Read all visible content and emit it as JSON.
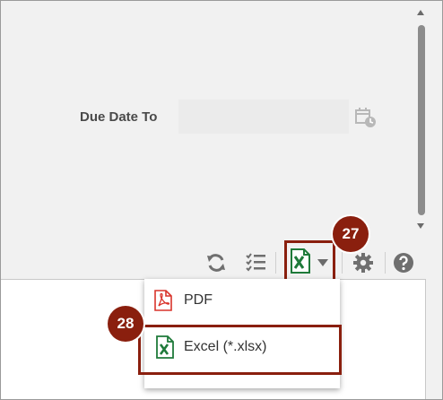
{
  "filters": {
    "due_date_to_label": "Due Date To",
    "due_date_to_value": ""
  },
  "toolbar": {
    "icons": [
      "refresh-icon",
      "list-icon",
      "excel-export-icon",
      "chevron-down-icon",
      "gear-icon",
      "help-icon"
    ]
  },
  "export_menu": {
    "items": [
      {
        "label": "PDF",
        "icon": "pdf-icon"
      },
      {
        "label": "Excel (*.xlsx)",
        "icon": "excel-icon"
      }
    ]
  },
  "callouts": {
    "export_step": "27",
    "excel_step": "28"
  },
  "colors": {
    "callout": "#8a1f0e",
    "excel_green": "#1f7a3a",
    "pdf_red": "#d9342b"
  }
}
